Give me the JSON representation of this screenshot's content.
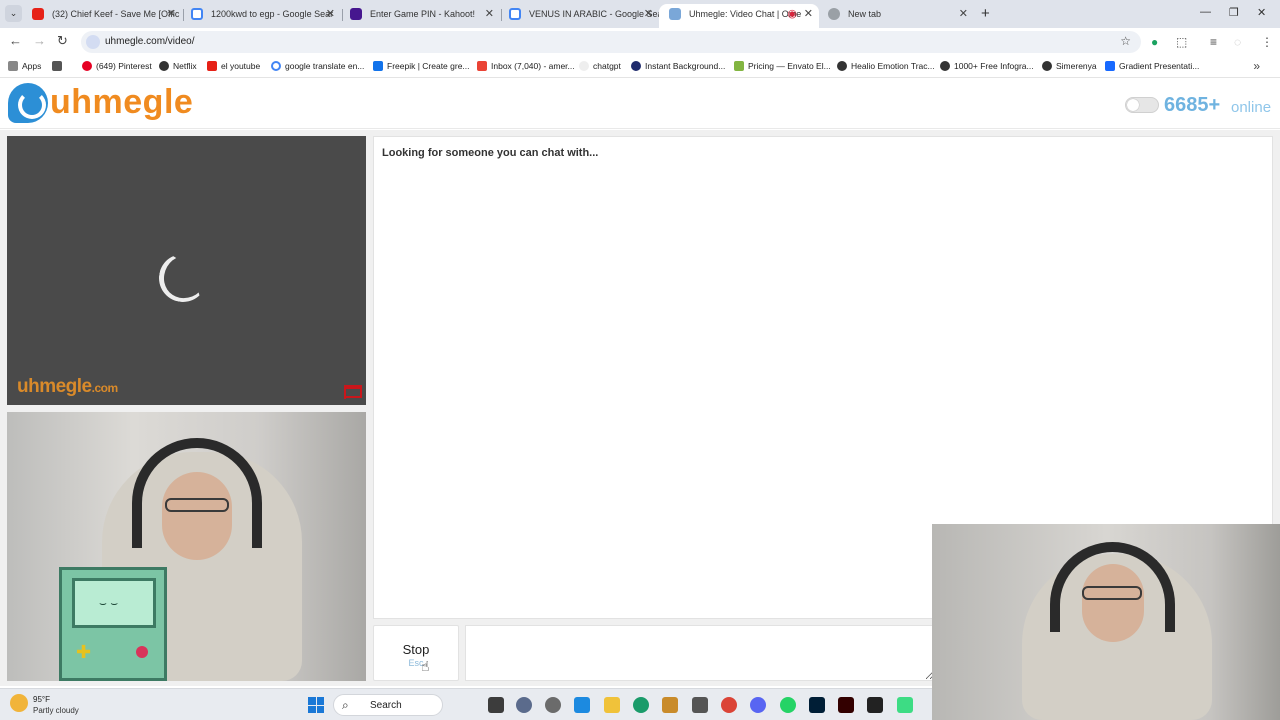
{
  "browser": {
    "tabs": [
      {
        "title": "(32) Chief Keef - Save Me [Offic",
        "active": false
      },
      {
        "title": "1200kwd to egp - Google Sear",
        "active": false
      },
      {
        "title": "Enter Game PIN - Kahoot!",
        "active": false
      },
      {
        "title": "VENUS IN ARABIC - Google Sea",
        "active": false
      },
      {
        "title": "Uhmegle: Video Chat | Ome",
        "active": true
      },
      {
        "title": "New tab",
        "active": false
      }
    ],
    "url": "uhmegle.com/video/",
    "bookmarks": [
      "Apps",
      "(649) Pinterest",
      "Netflix",
      "el youtube",
      "google translate en...",
      "Freepik | Create gre...",
      "Inbox (7,040) - amer...",
      "chatgpt",
      "Instant Background...",
      "Pricing — Envato El...",
      "Healio Emotion Trac...",
      "1000+ Free Infogra...",
      "Simerenya",
      "Gradient Presentati..."
    ]
  },
  "header": {
    "logo_text": "uhmegle",
    "online_count": "6685+",
    "online_label": "online"
  },
  "video": {
    "watermark": "uhmegle",
    "watermark_suffix": ".com"
  },
  "chat": {
    "status": "Looking for someone you can chat with..."
  },
  "controls": {
    "stop_label": "Stop",
    "stop_hint": "Esc"
  },
  "taskbar": {
    "weather_temp": "95°F",
    "weather_condition": "Partly cloudy",
    "search_label": "Search"
  },
  "colors": {
    "brand_orange": "#f08b20",
    "brand_blue": "#2c8fd6",
    "online_blue": "#6fb3e0",
    "report_red": "#c9161b"
  }
}
